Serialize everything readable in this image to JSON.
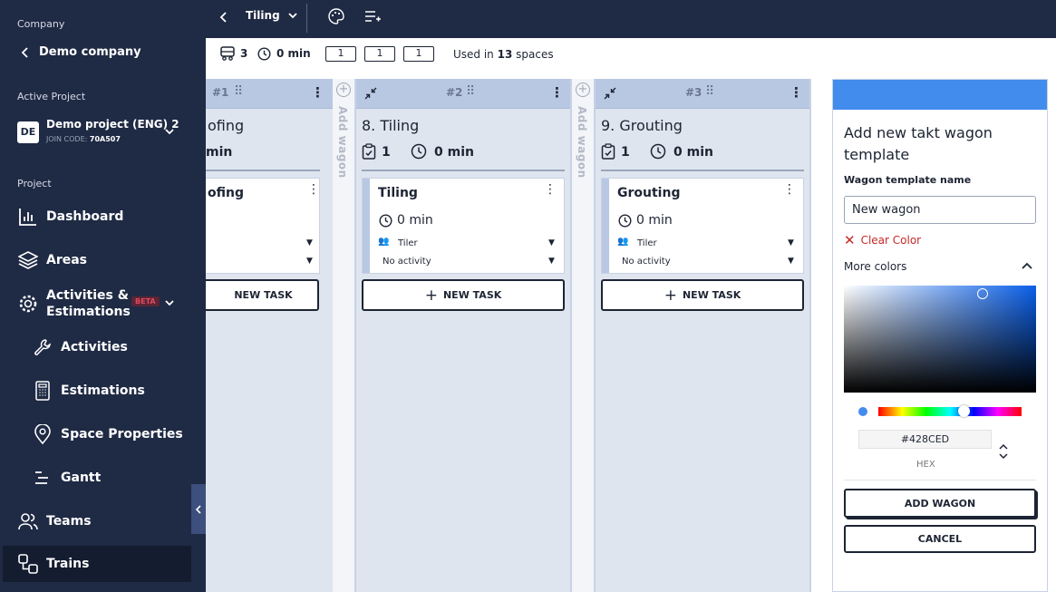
{
  "sidebar": {
    "company_label": "Company",
    "company_name": "Demo company",
    "active_project_label": "Active Project",
    "project_badge": "DE",
    "project_name": "Demo project (ENG) 2",
    "join_code_label": "JOIN CODE:",
    "join_code": "70A507",
    "project_section": "Project",
    "items": [
      {
        "label": "Dashboard",
        "icon": "bar-chart-icon"
      },
      {
        "label": "Areas",
        "icon": "layers-icon"
      },
      {
        "label": "Activities &",
        "label2": "Estimations",
        "icon": "gear-icon",
        "badge": "BETA"
      },
      {
        "label": "Activities",
        "icon": "wrench-icon"
      },
      {
        "label": "Estimations",
        "icon": "calculator-icon"
      },
      {
        "label": "Space Properties",
        "icon": "map-pin-icon"
      },
      {
        "label": "Gantt",
        "icon": "gantt-icon"
      },
      {
        "label": "Teams",
        "icon": "users-icon"
      },
      {
        "label": "Trains",
        "icon": "train-icon"
      }
    ]
  },
  "topbar": {
    "title": "Tiling"
  },
  "subbar": {
    "wagons_count": "3",
    "duration": "0 min",
    "box1": "1",
    "box2": "1",
    "box3": "1",
    "used_prefix": "Used in",
    "used_count": "13",
    "used_suffix": "spaces"
  },
  "columns": [
    {
      "num": "#1",
      "title": "ofing",
      "count": "",
      "duration": "min",
      "card_title": "ofing",
      "team": "",
      "activity": "",
      "new_task": "NEW TASK"
    },
    {
      "num": "#2",
      "title": "8. Tiling",
      "count": "1",
      "duration": "0 min",
      "card_title": "Tiling",
      "card_duration": "0 min",
      "team": "Tiler",
      "activity": "No activity",
      "new_task": "NEW TASK"
    },
    {
      "num": "#3",
      "title": "9. Grouting",
      "count": "1",
      "duration": "0 min",
      "card_title": "Grouting",
      "card_duration": "0 min",
      "team": "Tiler",
      "activity": "No activity",
      "new_task": "NEW TASK"
    }
  ],
  "add_wagon_label": "Add wagon",
  "panel": {
    "header_color": "#428CED",
    "title_line1": "Add new takt wagon",
    "title_line2": "template",
    "name_label": "Wagon template name",
    "name_value": "New wagon",
    "clear_color": "Clear Color",
    "more_colors": "More colors",
    "hex_value": "#428CED",
    "hex_label": "HEX",
    "add_button": "ADD WAGON",
    "cancel_button": "CANCEL"
  }
}
